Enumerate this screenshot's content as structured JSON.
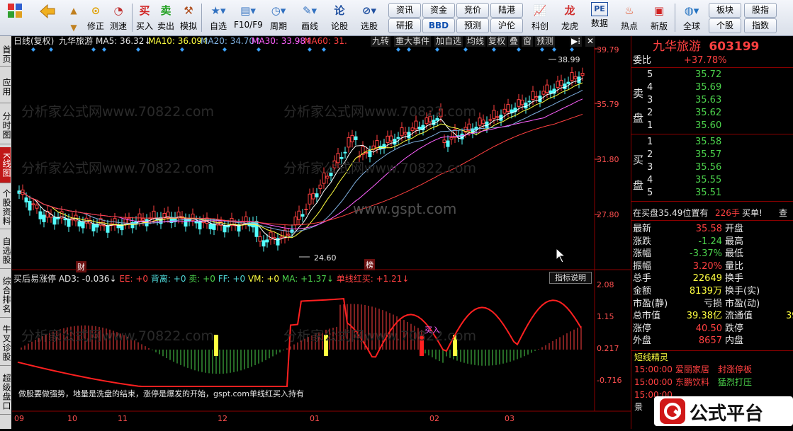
{
  "toolbar": {
    "buttons": [
      {
        "label": "",
        "icon": "grid-app-icon"
      },
      {
        "label": "",
        "icon": "back-arrow-icon"
      },
      {
        "label": "",
        "icon": "up-arrow-icon"
      },
      {
        "label": "修正",
        "icon": "correct-icon"
      },
      {
        "label": "测速",
        "icon": "speedtest-icon"
      },
      {
        "label": "买入",
        "icon": "buy-icon",
        "glyph": "买"
      },
      {
        "label": "卖出",
        "icon": "sell-icon",
        "glyph": "卖"
      },
      {
        "label": "模拟",
        "icon": "hammer-icon"
      },
      {
        "label": "自选",
        "icon": "star-folder-icon"
      },
      {
        "label": "F10/F9",
        "icon": "f10-icon"
      },
      {
        "label": "周期",
        "icon": "clock-icon"
      },
      {
        "label": "画线",
        "icon": "pen-icon"
      },
      {
        "label": "论股",
        "icon": "discuss-icon"
      },
      {
        "label": "选股",
        "icon": "search-stock-icon"
      },
      {
        "label": "科创",
        "icon": "chart-icon"
      },
      {
        "label": "龙虎",
        "icon": "dragon-icon"
      },
      {
        "label": "数据",
        "icon": "pe-icon",
        "glyph": "PE"
      },
      {
        "label": "热点",
        "icon": "fire-icon"
      },
      {
        "label": "新版",
        "icon": "new-version-icon"
      },
      {
        "label": "全球",
        "icon": "globe-icon"
      }
    ],
    "small_buttons": [
      "资讯",
      "资金",
      "竞价",
      "陆港",
      "研报",
      "BBD",
      "预测",
      "沪伦",
      "板块",
      "股指",
      "个股",
      "指数"
    ]
  },
  "sidebar": {
    "tabs": [
      "首页",
      "应用",
      "分时图",
      "K线图",
      "个股资料",
      "自选股",
      "综合排名",
      "牛叉诊股",
      "超级盘口"
    ]
  },
  "chart_header": {
    "period": "日线(复权)",
    "stock": "九华旅游",
    "ma5": "MA5: 36.32↓",
    "ma10": "MA10: 36.09↑",
    "ma20": "MA20: 34.70↑",
    "ma30": "MA30: 33.98↑",
    "ma60": "MA60: 31.",
    "tabs": [
      "九转",
      "重大事件",
      "加自选",
      "均线",
      "复权",
      "叠",
      "窗",
      "预测"
    ]
  },
  "watermarks": [
    "分析家公式网www.70822.com",
    "www.gspt.com"
  ],
  "chart_data": {
    "type": "candlestick",
    "price_axis": [
      "39.79",
      "35.79",
      "31.80",
      "27.80"
    ],
    "high_label": "38.99",
    "low_label": "24.60",
    "markers": [
      "财",
      "榜"
    ],
    "indicator_header": {
      "name": "买后易涨停",
      "ad3": "AD3: -0.036↓",
      "ee": "EE: +0",
      "bzh": "背离: +0",
      "sell": "卖: +0",
      "ff": "FF: +0",
      "vm": "VM: +0",
      "ma": "MA: +1.37↓",
      "dxhm": "单线红买: +1.21↓"
    },
    "indicator_button": "指标说明",
    "indicator_axis": [
      "2.08",
      "1.15",
      "0.217",
      "-0.716"
    ],
    "buy_label": "买入",
    "caption": "做股要做强势，地量是洗盘的结束，涨停是爆发的开始，gspt.com单线红买入持有",
    "x_axis": [
      "09",
      "10",
      "11",
      "12",
      "01",
      "02",
      "03"
    ]
  },
  "quote": {
    "name": "九华旅游",
    "code": "603199",
    "weibi_label": "委比",
    "weibi": "+37.78%",
    "sell_label": [
      "卖",
      "盘"
    ],
    "buy_label": [
      "买",
      "盘"
    ],
    "sells": [
      {
        "lvl": "5",
        "price": "35.72"
      },
      {
        "lvl": "4",
        "price": "35.69"
      },
      {
        "lvl": "3",
        "price": "35.63"
      },
      {
        "lvl": "2",
        "price": "35.62"
      },
      {
        "lvl": "1",
        "price": "35.60"
      }
    ],
    "buys": [
      {
        "lvl": "1",
        "price": "35.58"
      },
      {
        "lvl": "2",
        "price": "35.57"
      },
      {
        "lvl": "3",
        "price": "35.56"
      },
      {
        "lvl": "4",
        "price": "35.55"
      },
      {
        "lvl": "5",
        "price": "35.51"
      }
    ],
    "order_line": "在买盘35.49位置有",
    "order_qty": "226手",
    "order_tag": "买单!",
    "order_more": "查",
    "stats": [
      {
        "k": "最新",
        "v": "35.58",
        "k2": "开盘",
        "v2": ""
      },
      {
        "k": "涨跌",
        "v": "-1.24",
        "k2": "最高",
        "v2": ""
      },
      {
        "k": "涨幅",
        "v": "-3.37%",
        "k2": "最低",
        "v2": ""
      },
      {
        "k": "振幅",
        "v": "3.20%",
        "k2": "量比",
        "v2": ""
      },
      {
        "k": "总手",
        "v": "22649",
        "k2": "换手",
        "v2": ""
      },
      {
        "k": "金额",
        "v": "8139万",
        "k2": "换手(实)",
        "v2": ""
      },
      {
        "k": "市盈(静)",
        "v": "亏损",
        "k2": "市盈(动)",
        "v2": ""
      },
      {
        "k": "总市值",
        "v": "39.38亿",
        "k2": "流通值",
        "v2": "39"
      },
      {
        "k": "涨停",
        "v": "40.50",
        "k2": "跌停",
        "v2": ""
      },
      {
        "k": "外盘",
        "v": "8657",
        "k2": "内盘",
        "v2": ""
      }
    ],
    "elf_title": "短线精灵",
    "elf_items": [
      {
        "time": "15:00:00",
        "name": "爱丽家居",
        "event": "封涨停板"
      },
      {
        "time": "15:00:00",
        "name": "东鹏饮料",
        "event": "猛烈打压"
      },
      {
        "time": "15:00:00",
        "name": "",
        "event": ""
      }
    ],
    "elf_footer": "景"
  },
  "brand": {
    "text": "公式平台"
  }
}
